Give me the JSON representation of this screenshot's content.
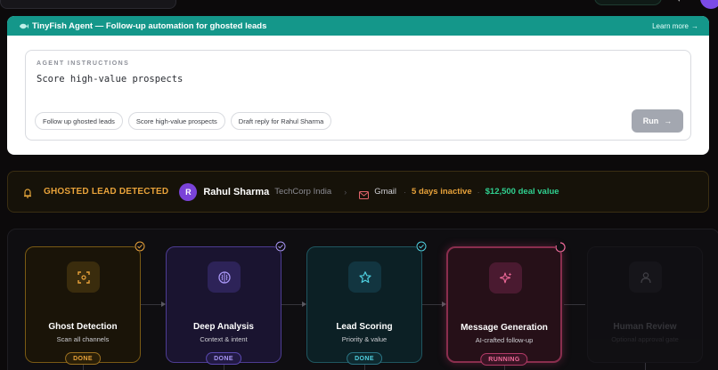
{
  "agent": {
    "header_title": "TinyFish Agent — Follow-up automation for ghosted leads",
    "learn_more": "Learn more",
    "instructions_label": "AGENT INSTRUCTIONS",
    "instructions_value": "Score high-value prospects",
    "chips": [
      "Follow up ghosted leads",
      "Score high-value prospects",
      "Draft reply for Rahul Sharma"
    ],
    "run_label": "Run"
  },
  "alert": {
    "title": "GHOSTED LEAD DETECTED",
    "avatar_initial": "R",
    "name": "Rahul Sharma",
    "company": "TechCorp India",
    "channel": "Gmail",
    "inactive": "5 days inactive",
    "deal_value": "$12,500 deal value"
  },
  "pipeline": {
    "steps": [
      {
        "name": "Ghost Detection",
        "sub": "Scan all channels",
        "status": "DONE",
        "icon": "scan-icon",
        "color": "#e8a23a"
      },
      {
        "name": "Deep Analysis",
        "sub": "Context & intent",
        "status": "DONE",
        "icon": "brain-icon",
        "color": "#a896f5"
      },
      {
        "name": "Lead Scoring",
        "sub": "Priority & value",
        "status": "DONE",
        "icon": "star-icon",
        "color": "#4fd0e0"
      },
      {
        "name": "Message Generation",
        "sub": "AI-crafted follow-up",
        "status": "RUNNING",
        "icon": "sparkle-icon",
        "color": "#f06a9a"
      },
      {
        "name": "Human Review",
        "sub": "Optional approval gate",
        "status": "",
        "icon": "user-icon",
        "color": "#55545c"
      }
    ]
  },
  "colors": {
    "teal_header": "#14978a",
    "warning": "#e8a23a",
    "success": "#2fcf8f",
    "purple_avatar": "#7a43d8"
  }
}
